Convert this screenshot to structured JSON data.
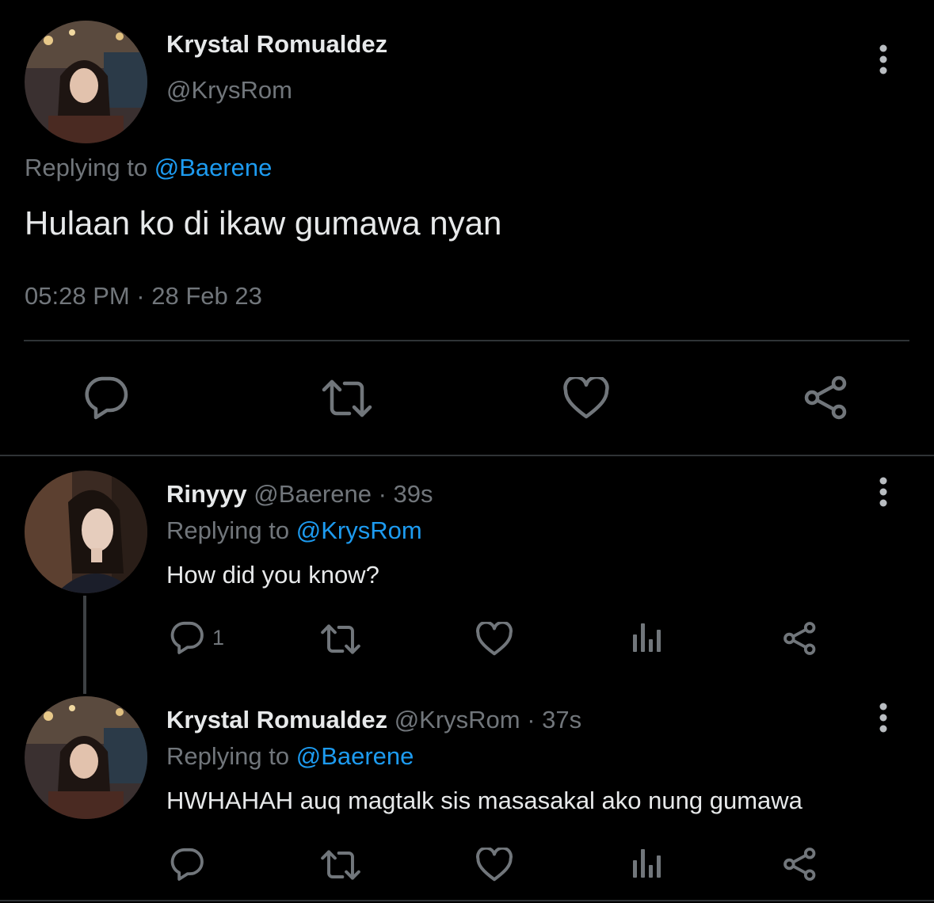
{
  "main_tweet": {
    "author_name": "Krystal Romualdez",
    "author_handle": "@KrysRom",
    "replying_prefix": "Replying to",
    "replying_to": "@Baerene",
    "text": "Hulaan ko di ikaw gumawa nyan",
    "timestamp": "05:28 PM · 28 Feb 23"
  },
  "replies": [
    {
      "author_name": "Rinyyy",
      "meta": "@Baerene · 39s",
      "replying_prefix": "Replying to",
      "replying_to": "@KrysRom",
      "text": "How did you know?",
      "reply_count": "1"
    },
    {
      "author_name": "Krystal Romualdez",
      "meta": "@KrysRom · 37s",
      "replying_prefix": "Replying to",
      "replying_to": "@Baerene",
      "text": "HWHAHAH auq magtalk sis masasakal ako nung gumawa",
      "reply_count": ""
    }
  ],
  "icons": {
    "reply": "reply-icon",
    "retweet": "retweet-icon",
    "like": "heart-icon",
    "views": "views-icon",
    "share": "share-icon",
    "more": "more-vertical-icon"
  },
  "colors": {
    "background": "#000000",
    "text": "#e7e9ea",
    "muted": "#71767b",
    "link": "#1d9bf0",
    "divider": "#2f3336"
  }
}
